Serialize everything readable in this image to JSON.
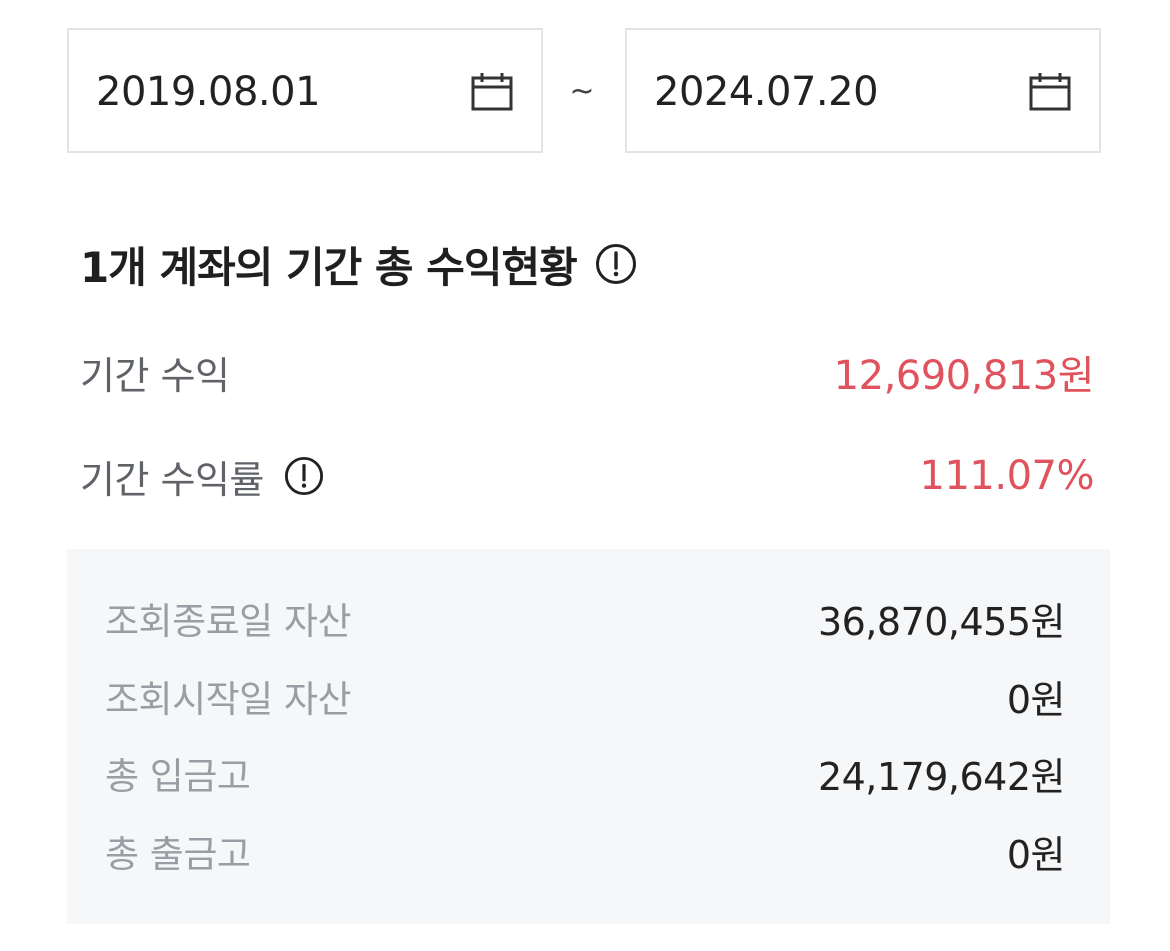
{
  "date_range": {
    "start": "2019.08.01",
    "separator": "~",
    "end": "2024.07.20",
    "calendar_icon": "calendar-icon"
  },
  "section": {
    "title": "1개 계좌의 기간 총 수익현황",
    "info_icon": "info-circle-icon"
  },
  "summary": {
    "period_profit_label": "기간 수익",
    "period_profit_value": "12,690,813원",
    "period_return_label": "기간 수익률",
    "period_return_value": "111.07%",
    "highlight_color": "#e0525d"
  },
  "details": {
    "rows": [
      {
        "label": "조회종료일 자산",
        "value": "36,870,455원"
      },
      {
        "label": "조회시작일 자산",
        "value": "0원"
      },
      {
        "label": "총 입금고",
        "value": "24,179,642원"
      },
      {
        "label": "총 출금고",
        "value": "0원"
      }
    ]
  }
}
